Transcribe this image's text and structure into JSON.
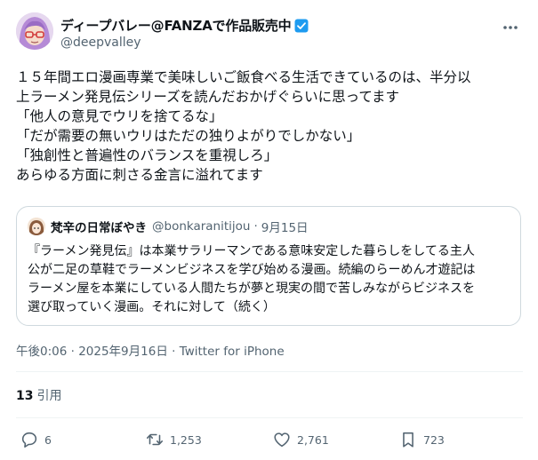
{
  "author": {
    "display_name": "ディープバレー@FANZAで作品販売中",
    "handle": "@deepvalley",
    "verified": true,
    "avatar_icon": "anime-avatar-icon"
  },
  "tweet": {
    "lines": [
      "１５年間エロ漫画専業で美味しいご飯食べる生活できているのは、半分以",
      "上ラーメン発見伝シリーズを読んだおかげぐらいに思ってます",
      "「他人の意見でウリを捨てるな」",
      "「だが需要の無いウリはただの独りよがりでしかない」",
      "「独創性と普遍性のバランスを重視しろ」",
      "あらゆる方面に刺さる金言に溢れてます"
    ]
  },
  "quote": {
    "display_name": "梵辛の日常ぼやき",
    "handle": "@bonkaranitijou",
    "separator": "·",
    "date": "9月15日",
    "lines": [
      "『ラーメン発見伝』は本業サラリーマンである意味安定した暮らしをしてる主人",
      "公が二足の草鞋でラーメンビジネスを学び始める漫画。続編のらーめん才遊記は",
      "ラーメン屋を本業にしている人間たちが夢と現実の間で苦しみながらビジネスを",
      "選び取っていく漫画。それに対して（続く）"
    ]
  },
  "meta": {
    "time": "午後0:06",
    "sep1": " · ",
    "date": "2025年9月16日",
    "sep2": " · ",
    "source": "Twitter for iPhone"
  },
  "stats": {
    "quotes_count": "13",
    "quotes_label": "引用"
  },
  "actions": {
    "replies": "6",
    "retweets": "1,253",
    "likes": "2,761",
    "bookmarks": "723"
  },
  "colors": {
    "text": "#0f1419",
    "muted": "#536471",
    "border": "#cfd9de",
    "divider": "#eff3f4",
    "verified": "#1d9bf0"
  }
}
